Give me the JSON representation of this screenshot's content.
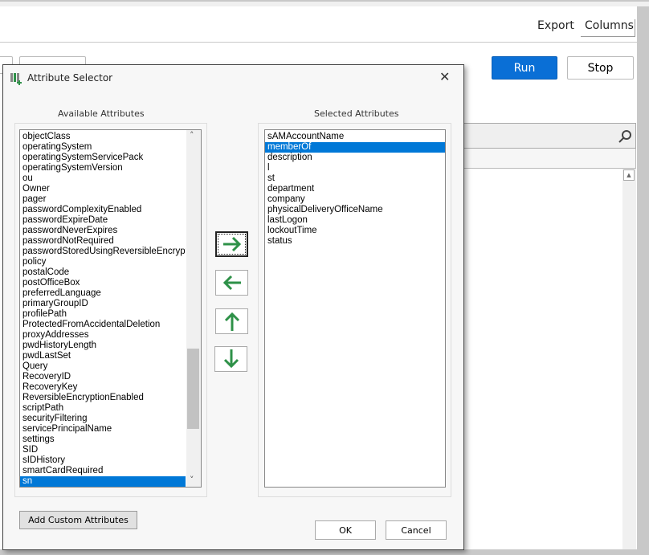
{
  "header": {
    "export": "Export",
    "columns": "Columns"
  },
  "toolbar": {
    "run": "Run",
    "stop": "Stop"
  },
  "dialog": {
    "title": "Attribute Selector",
    "available_label": "Available Attributes",
    "selected_label": "Selected Attributes",
    "available": [
      "objectClass",
      "operatingSystem",
      "operatingSystemServicePack",
      "operatingSystemVersion",
      "ou",
      "Owner",
      "pager",
      "passwordComplexityEnabled",
      "passwordExpireDate",
      "passwordNeverExpires",
      "passwordNotRequired",
      "passwordStoredUsingReversibleEncryption",
      "policy",
      "postalCode",
      "postOfficeBox",
      "preferredLanguage",
      "primaryGroupID",
      "profilePath",
      "ProtectedFromAccidentalDeletion",
      "proxyAddresses",
      "pwdHistoryLength",
      "pwdLastSet",
      "Query",
      "RecoveryID",
      "RecoveryKey",
      "ReversibleEncryptionEnabled",
      "scriptPath",
      "securityFiltering",
      "servicePrincipalName",
      "settings",
      "SID",
      "sIDHistory",
      "smartCardRequired",
      "sn"
    ],
    "available_selected": "sn",
    "selected": [
      "sAMAccountName",
      "memberOf",
      "description",
      "l",
      "st",
      "department",
      "company",
      "physicalDeliveryOfficeName",
      "lastLogon",
      "lockoutTime",
      "status"
    ],
    "selected_selected": "memberOf",
    "add_custom": "Add Custom Attributes",
    "ok": "OK",
    "cancel": "Cancel",
    "accent": "#0078d7",
    "arrow_color": "#2e9148"
  }
}
